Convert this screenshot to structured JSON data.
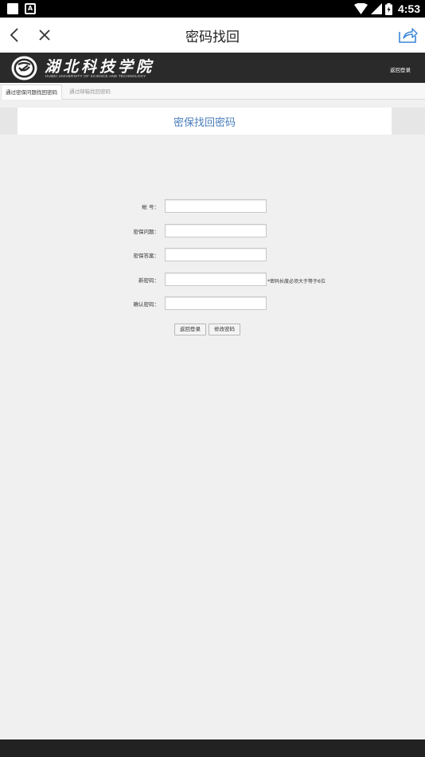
{
  "status_bar": {
    "time": "4:53",
    "icons": [
      "notification-square-icon",
      "a-badge-icon",
      "wifi-icon",
      "signal-icon",
      "battery-icon"
    ]
  },
  "header": {
    "title": "密码找回",
    "icons": [
      "back-arrow-icon",
      "close-icon",
      "share-icon"
    ]
  },
  "banner": {
    "school_name": "湖北科技学院",
    "school_name_en": "HUBEI UNIVERSITY OF SCIENCE AND TECHNOLOGY",
    "login_link": "返回登录"
  },
  "tabs": [
    {
      "label": "通过密保问题找回密码",
      "active": true
    },
    {
      "label": "通过邮箱找回密码",
      "active": false
    }
  ],
  "section": {
    "title": "密保找回密码"
  },
  "form": {
    "fields": [
      {
        "label": "帐 号：",
        "value": ""
      },
      {
        "label": "密保问题：",
        "value": ""
      },
      {
        "label": "密保答案：",
        "value": ""
      },
      {
        "label": "新密码：",
        "value": "",
        "hint": "*密码长度必须大于等于6位"
      },
      {
        "label": "确认密码：",
        "value": ""
      }
    ],
    "buttons": {
      "back": "返回登录",
      "submit": "修改密码"
    }
  },
  "colors": {
    "banner_bg": "#2a2a2a",
    "section_title": "#4a7dbb",
    "share_icon": "#3a86d8"
  }
}
